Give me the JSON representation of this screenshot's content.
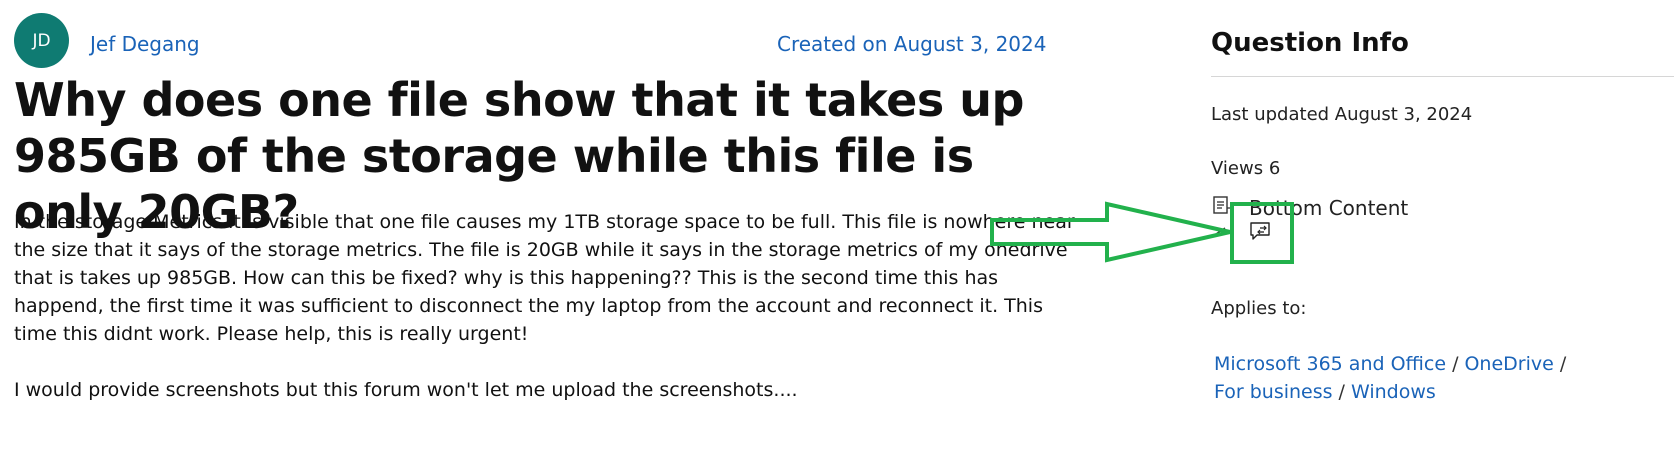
{
  "author": {
    "initials": "JD",
    "name": "Jef Degang",
    "created": "Created on August 3, 2024"
  },
  "question": {
    "title": "Why does one file show that it takes up 985GB of the storage while this file is only 20GB?",
    "body_p1": "In the storage Metrics it is visible that one file causes my 1TB storage space to be full. This file is nowhere near the size that it says of the storage metrics. The file is 20GB while it says in the storage metrics of my onedrive that is takes up 985GB. How can this be fixed? why is this happening?? This is the second time this has happend, the first time it was sufficient to disconnect the my laptop from the account and reconnect it. This time this didnt work. Please help, this is really urgent!",
    "body_p2": "I would provide screenshots but this forum won't let me upload the screenshots...."
  },
  "info": {
    "title": "Question Info",
    "last_updated": "Last updated August 3, 2024",
    "views": "Views 6",
    "bottom_content": "Bottom Content",
    "applies_to": "Applies to:",
    "crumbs": [
      "Microsoft 365 and Office",
      "OneDrive",
      "For business",
      "Windows"
    ],
    "separator": "/"
  },
  "colors": {
    "avatar": "#0f7b72",
    "link": "#1a63b8",
    "annotation": "#22b14c"
  },
  "icons": [
    "document-icon",
    "chat-icon",
    "cut-icon",
    "arrow-annotation",
    "highlight-box"
  ]
}
